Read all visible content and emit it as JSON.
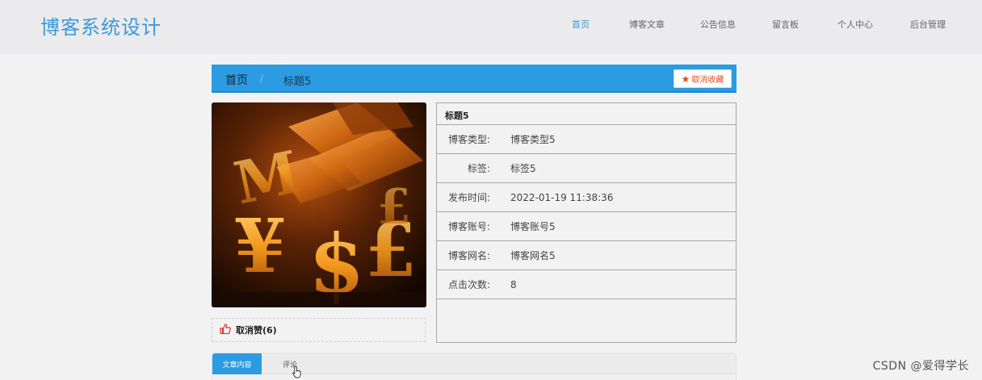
{
  "header": {
    "title": "博客系统设计",
    "nav": [
      {
        "label": "首页",
        "active": true
      },
      {
        "label": "博客文章",
        "active": false
      },
      {
        "label": "公告信息",
        "active": false
      },
      {
        "label": "留言板",
        "active": false
      },
      {
        "label": "个人中心",
        "active": false
      },
      {
        "label": "后台管理",
        "active": false
      }
    ]
  },
  "breadcrumb": {
    "home": "首页",
    "separator": "/",
    "current": "标题5",
    "favorite_button": "取消收藏",
    "favorite_icon": "star-icon"
  },
  "cover": {
    "icon": "currency-symbols-image"
  },
  "like": {
    "icon": "thumbs-up-icon",
    "label": "取消赞(6)"
  },
  "info": {
    "title": "标题5",
    "rows": [
      {
        "key": "博客类型:",
        "value": "博客类型5"
      },
      {
        "key": "标签:",
        "value": "标签5"
      },
      {
        "key": "发布时间:",
        "value": "2022-01-19 11:38:36"
      },
      {
        "key": "博客账号:",
        "value": "博客账号5"
      },
      {
        "key": "博客网名:",
        "value": "博客网名5"
      },
      {
        "key": "点击次数:",
        "value": "8"
      }
    ]
  },
  "tabs": [
    {
      "label": "文章内容",
      "active": true
    },
    {
      "label": "评论",
      "active": false
    }
  ],
  "watermark": "CSDN @爱得学长",
  "colors": {
    "accent": "#2b9be2",
    "title": "#3a9ad9",
    "favorite": "#e24a1c",
    "like": "#d9332b"
  }
}
